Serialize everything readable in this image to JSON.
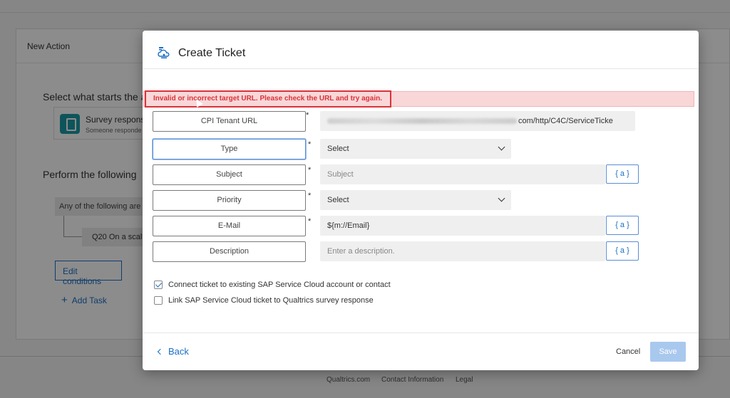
{
  "background": {
    "card_title": "New Action",
    "select_start": "Select what starts the a",
    "survey_title": "Survey respons",
    "survey_sub": "Someone responde",
    "perform": "Perform the following",
    "condition": "Any of the following are",
    "question": "Q20 On a scal",
    "edit_conditions": "Edit conditions",
    "add_task": "Add Task",
    "footer_links": [
      "Qualtrics.com",
      "Contact Information",
      "Legal"
    ]
  },
  "modal": {
    "title": "Create Ticket",
    "icon": "cloud-ticket-icon",
    "error_message": "Invalid or incorrect target URL. Please check the URL and try again.",
    "fields": [
      {
        "label": "CPI Tenant URL",
        "required": "*",
        "value_visible_suffix": "com/http/C4C/ServiceTicke"
      },
      {
        "label": "Type",
        "required": "*",
        "value": "Select"
      },
      {
        "label": "Subject",
        "required": "*",
        "placeholder": "Subject",
        "var_button": "{ a }"
      },
      {
        "label": "Priority",
        "required": "*",
        "value": "Select"
      },
      {
        "label": "E-Mail",
        "required": "*",
        "value": "${m://Email}",
        "var_button": "{ a }"
      },
      {
        "label": "Description",
        "placeholder": "Enter a description.",
        "var_button": "{ a }"
      }
    ],
    "checkboxes": [
      {
        "label": "Connect ticket to existing SAP Service Cloud account or contact",
        "checked": true
      },
      {
        "label": "Link SAP Service Cloud ticket to Qualtrics survey response",
        "checked": false
      }
    ],
    "back": "Back",
    "cancel": "Cancel",
    "save": "Save"
  },
  "colors": {
    "accent": "#1a6fc4",
    "error": "#d9333a",
    "save_disabled": "#a9c8ee"
  }
}
